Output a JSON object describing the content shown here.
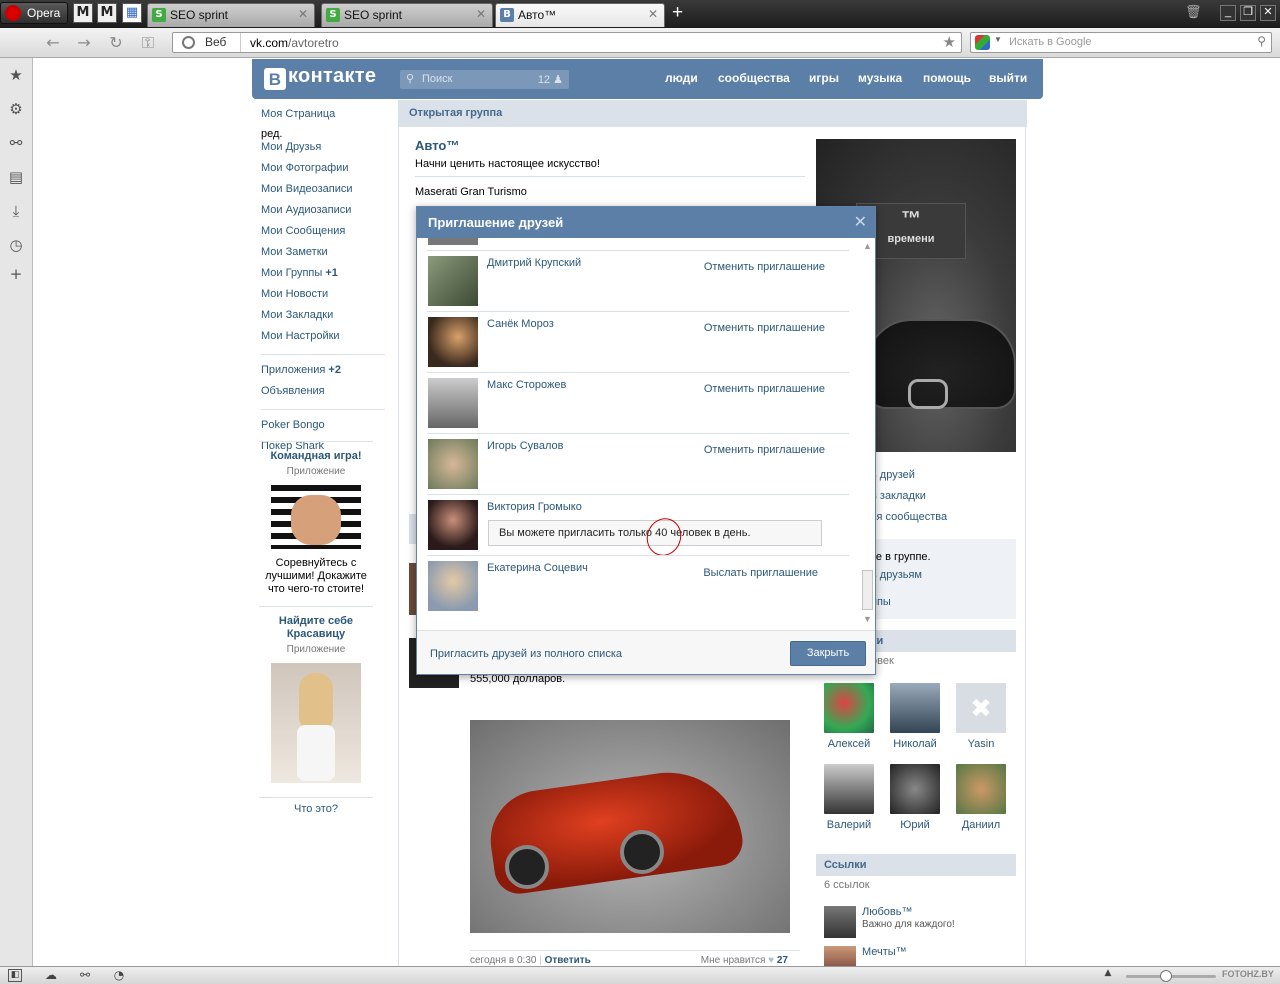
{
  "browser": {
    "opera_label": "Opera",
    "speed_dials": [
      "M",
      "M",
      "▦"
    ],
    "tabs": [
      {
        "title": "SEO sprint",
        "icon": "S"
      },
      {
        "title": "SEO sprint",
        "icon": "S"
      },
      {
        "title": "Авто™",
        "icon": "В"
      }
    ],
    "new_tab": "+",
    "web_label": "Веб",
    "url_domain": "vk.com",
    "url_path": "/avtoretro",
    "search_placeholder": "Искать в Google",
    "watermark": "FOTOHZ.BY"
  },
  "vk": {
    "logo": "контакте",
    "logo_letter": "В",
    "search_placeholder": "Поиск",
    "search_count": "12",
    "nav": [
      "люди",
      "сообщества",
      "игры",
      "музыка",
      "помощь",
      "выйти"
    ]
  },
  "left_menu": {
    "edit": "ред.",
    "items1": [
      "Моя Страница",
      "Мои Друзья",
      "Мои Фотографии",
      "Мои Видеозаписи",
      "Мои Аудиозаписи",
      "Мои Сообщения",
      "Мои Заметки",
      "Мои Группы",
      "Мои Новости",
      "Мои Закладки",
      "Мои Настройки"
    ],
    "groups_badge": "+1",
    "apps": "Приложения",
    "apps_badge": "+2",
    "ads": "Объявления",
    "games": [
      "Poker Bongo",
      "Покер Shark"
    ]
  },
  "ads": [
    {
      "title": "Командная игра!",
      "sub": "Приложение",
      "text": "Соревнуйтесь с лучшими! Докажите что чего-то стоите!"
    },
    {
      "title": "Найдите себе Красавицу",
      "sub": "Приложение"
    }
  ],
  "ads_what": "Что это?",
  "group": {
    "header": "Открытая группа",
    "name": "Авто™",
    "status": "Начни ценить настоящее искусство!",
    "info": "Maserati Gran Turismo"
  },
  "right_col": {
    "logo_text": "™",
    "logo_sub": "времени",
    "links": [
      "ь друзей",
      "в закладки",
      "ся сообщества"
    ],
    "gray_lines": [
      "те в группе.",
      "ь друзьям",
      "ппы"
    ],
    "members_hdr": "ки",
    "members_sub": "овек",
    "members": [
      "Алексей",
      "Николай",
      "Yasin",
      "Валерий",
      "Юрий",
      "Даниил"
    ],
    "links_hdr": "Ссылки",
    "links_sub": "6 ссылок",
    "link_items": [
      {
        "title": "Любовь™",
        "sub": "Важно для каждого!"
      },
      {
        "title": "Мечты™",
        "sub": "..."
      }
    ]
  },
  "post": {
    "text": "от 0 до 100км/ч за 2,8 секунды. Оснащен Twin Turbo All Aluminum V8 двигателем, в 750 л.с. Цена базовой модели 555,000 долларов.",
    "time": "сегодня в 0:30",
    "reply": "Ответить",
    "like_label": "Мне нравится",
    "likes": "27"
  },
  "modal": {
    "title": "Приглашение друзей",
    "close_x": "✕",
    "friends": [
      {
        "name": "Дмитрий Крупский",
        "action": "Отменить приглашение"
      },
      {
        "name": "Санёк Мороз",
        "action": "Отменить приглашение"
      },
      {
        "name": "Макс Сторожев",
        "action": "Отменить приглашение"
      },
      {
        "name": "Игорь Сувалов",
        "action": "Отменить приглашение"
      },
      {
        "name": "Виктория Громыко",
        "action": ""
      },
      {
        "name": "Екатерина Соцевич",
        "action": "Выслать приглашение"
      }
    ],
    "limit_msg": "Вы можете пригласить только 40 человек в день.",
    "invite_all": "Пригласить друзей из полного списка",
    "close_btn": "Закрыть"
  },
  "colors": {
    "vk_blue": "#5b7fa6",
    "link": "#2b587a",
    "header_bg": "#dae1e8"
  }
}
